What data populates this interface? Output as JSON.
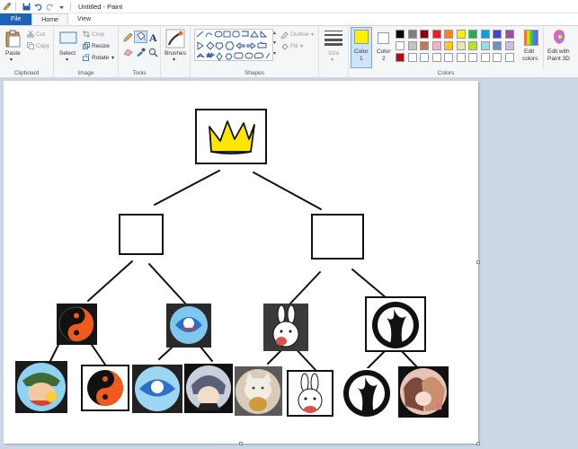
{
  "window": {
    "title": "Untitled - Paint"
  },
  "tabs": {
    "file": "File",
    "home": "Home",
    "view": "View"
  },
  "clipboard": {
    "paste": "Paste",
    "cut": "Cut",
    "copy": "Copy",
    "group": "Clipboard"
  },
  "image": {
    "select": "Select",
    "crop": "Crop",
    "resize": "Resize",
    "rotate": "Rotate",
    "group": "Image"
  },
  "tools": {
    "group": "Tools"
  },
  "brushes": {
    "label": "Brushes"
  },
  "shapes": {
    "outline": "Outline",
    "fill": "Fill",
    "group": "Shapes"
  },
  "size": {
    "label": "Size"
  },
  "colors": {
    "color1_label": "Color",
    "color1_num": "1",
    "color2_label": "Color",
    "color2_num": "2",
    "edit": "Edit",
    "edit2": "colors",
    "paint3d": "Edit with",
    "paint3d2": "Paint 3D",
    "group": "Colors",
    "color1_value": "#ffef00",
    "color2_value": "#ffffff",
    "palette": [
      "#000000",
      "#7f7f7f",
      "#880015",
      "#ed1c24",
      "#ff7f27",
      "#fff200",
      "#22b14c",
      "#00a2e8",
      "#3f48cc",
      "#a349a4",
      "#ffffff",
      "#c3c3c3",
      "#b97a57",
      "#ffaec9",
      "#ffc90e",
      "#efe4b0",
      "#b5e61d",
      "#99d9ea",
      "#7092be",
      "#c8bfe7",
      "#b00e12",
      "#ffffff",
      "#ffffff",
      "#ffffff",
      "#ffffff",
      "#ffffff",
      "#ffffff",
      "#ffffff",
      "#ffffff",
      "#ffffff"
    ]
  }
}
